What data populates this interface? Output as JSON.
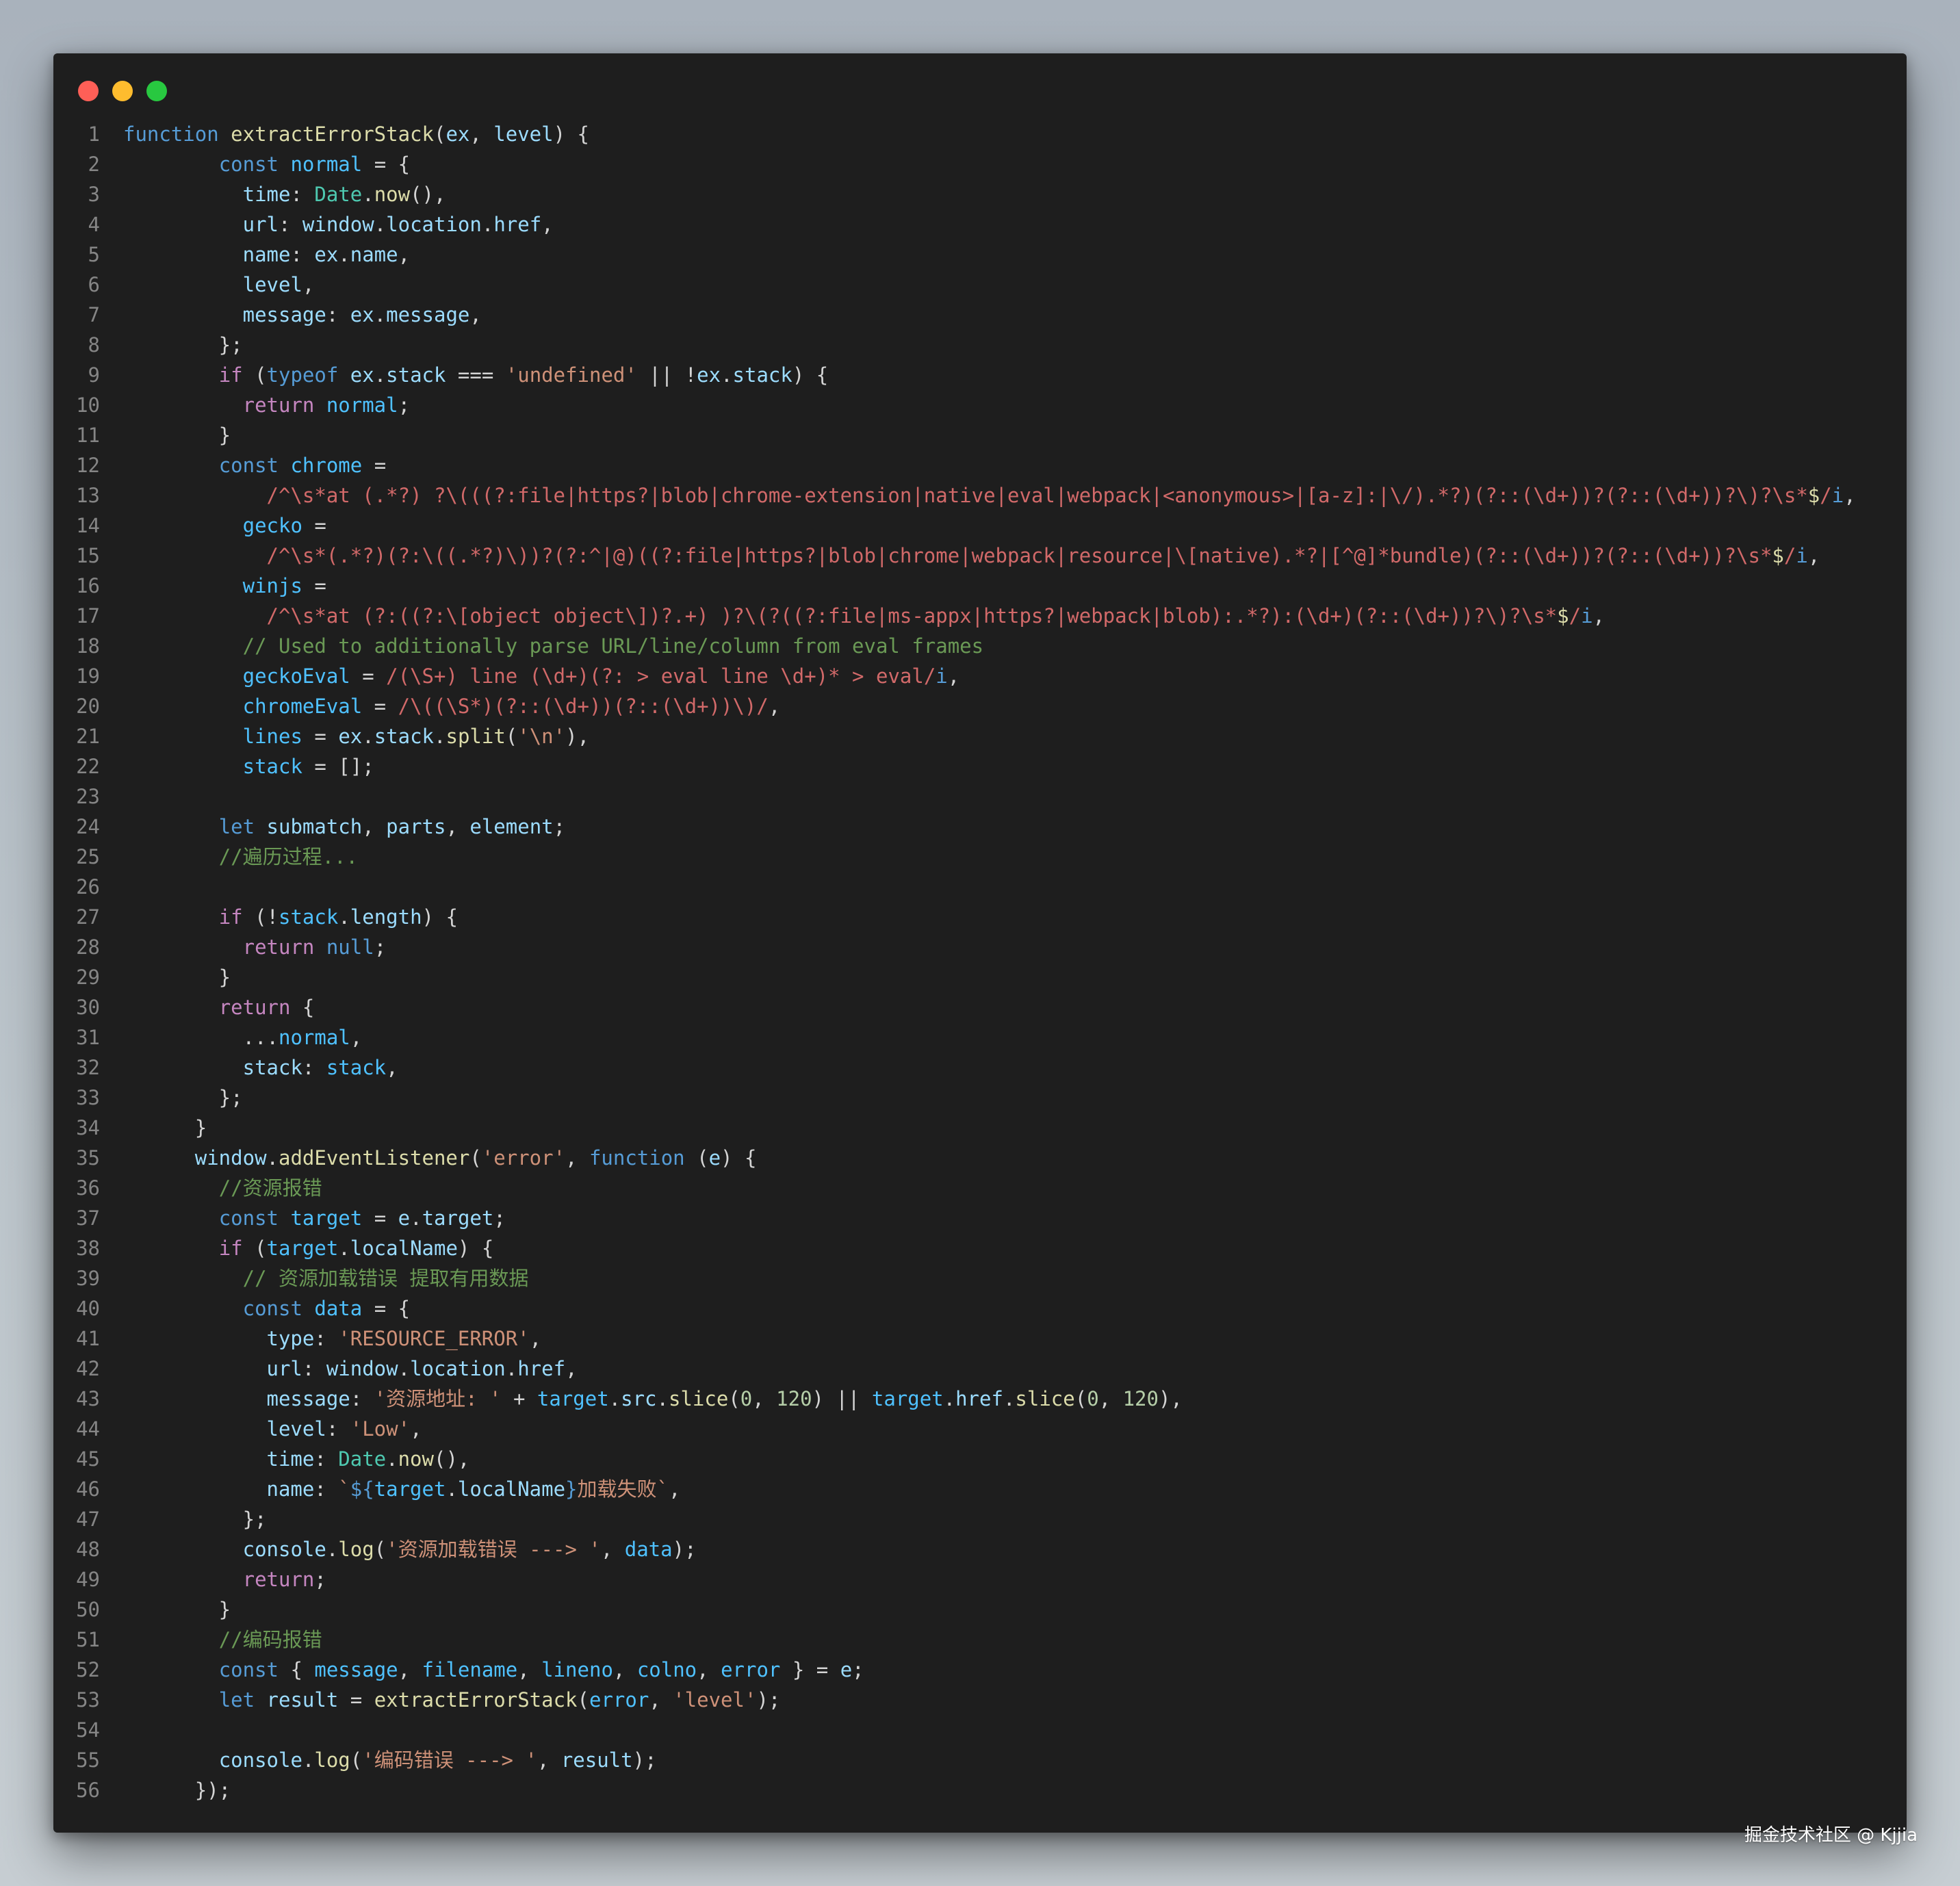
{
  "window": {
    "controls": {
      "close_color": "#ff5f57",
      "minimize_color": "#febc2e",
      "maximize_color": "#28c840"
    }
  },
  "code": {
    "lines": [
      [
        [
          "k",
          "function"
        ],
        [
          "t",
          " "
        ],
        [
          "f",
          "extractErrorStack"
        ],
        [
          "t",
          "("
        ],
        [
          "v",
          "ex"
        ],
        [
          "t",
          ", "
        ],
        [
          "v",
          "level"
        ],
        [
          "t",
          ") {"
        ]
      ],
      [
        [
          "t",
          "        "
        ],
        [
          "k",
          "const"
        ],
        [
          "t",
          " "
        ],
        [
          "b",
          "normal"
        ],
        [
          "t",
          " = {"
        ]
      ],
      [
        [
          "t",
          "          "
        ],
        [
          "v",
          "time"
        ],
        [
          "t",
          ": "
        ],
        [
          "t2",
          "Date"
        ],
        [
          "t",
          "."
        ],
        [
          "f",
          "now"
        ],
        [
          "t",
          "(),"
        ]
      ],
      [
        [
          "t",
          "          "
        ],
        [
          "v",
          "url"
        ],
        [
          "t",
          ": "
        ],
        [
          "v",
          "window"
        ],
        [
          "t",
          "."
        ],
        [
          "v",
          "location"
        ],
        [
          "t",
          "."
        ],
        [
          "v",
          "href"
        ],
        [
          "t",
          ","
        ]
      ],
      [
        [
          "t",
          "          "
        ],
        [
          "v",
          "name"
        ],
        [
          "t",
          ": "
        ],
        [
          "v",
          "ex"
        ],
        [
          "t",
          "."
        ],
        [
          "v",
          "name"
        ],
        [
          "t",
          ","
        ]
      ],
      [
        [
          "t",
          "          "
        ],
        [
          "v",
          "level"
        ],
        [
          "t",
          ","
        ]
      ],
      [
        [
          "t",
          "          "
        ],
        [
          "v",
          "message"
        ],
        [
          "t",
          ": "
        ],
        [
          "v",
          "ex"
        ],
        [
          "t",
          "."
        ],
        [
          "v",
          "message"
        ],
        [
          "t",
          ","
        ]
      ],
      [
        [
          "t",
          "        };"
        ]
      ],
      [
        [
          "t",
          "        "
        ],
        [
          "c",
          "if"
        ],
        [
          "t",
          " ("
        ],
        [
          "k",
          "typeof"
        ],
        [
          "t",
          " "
        ],
        [
          "v",
          "ex"
        ],
        [
          "t",
          "."
        ],
        [
          "v",
          "stack"
        ],
        [
          "t",
          " === "
        ],
        [
          "s",
          "'undefined'"
        ],
        [
          "t",
          " || !"
        ],
        [
          "v",
          "ex"
        ],
        [
          "t",
          "."
        ],
        [
          "v",
          "stack"
        ],
        [
          "t",
          ") {"
        ]
      ],
      [
        [
          "t",
          "          "
        ],
        [
          "c",
          "return"
        ],
        [
          "t",
          " "
        ],
        [
          "b",
          "normal"
        ],
        [
          "t",
          ";"
        ]
      ],
      [
        [
          "t",
          "        }"
        ]
      ],
      [
        [
          "t",
          "        "
        ],
        [
          "k",
          "const"
        ],
        [
          "t",
          " "
        ],
        [
          "b",
          "chrome"
        ],
        [
          "t",
          " ="
        ]
      ],
      [
        [
          "t",
          "            "
        ],
        [
          "r",
          "/^\\s*at (.*?) ?\\(((?:file|https?|blob|chrome-extension|native|eval|webpack|<anonymous>|[a-z]:|\\/).*?)(?::(\\d+))?(?::(\\d+))?\\)?\\s*"
        ],
        [
          "y",
          "$"
        ],
        [
          "r",
          "/"
        ],
        [
          "k",
          "i"
        ],
        [
          "t",
          ","
        ]
      ],
      [
        [
          "t",
          "          "
        ],
        [
          "b",
          "gecko"
        ],
        [
          "t",
          " ="
        ]
      ],
      [
        [
          "t",
          "            "
        ],
        [
          "r",
          "/^\\s*(.*?)(?:\\((.*?)\\))?(?:^|@)((?:file|https?|blob|chrome|webpack|resource|\\[native).*?|[^@]*bundle)(?::(\\d+))?(?::(\\d+))?\\s*"
        ],
        [
          "y",
          "$"
        ],
        [
          "r",
          "/"
        ],
        [
          "k",
          "i"
        ],
        [
          "t",
          ","
        ]
      ],
      [
        [
          "t",
          "          "
        ],
        [
          "b",
          "winjs"
        ],
        [
          "t",
          " ="
        ]
      ],
      [
        [
          "t",
          "            "
        ],
        [
          "r",
          "/^\\s*at (?:((?:\\[object object\\])?.+) )?\\(?((?:file|ms-appx|https?|webpack|blob):.*?):(\\d+)(?::(\\d+))?\\)?\\s*"
        ],
        [
          "y",
          "$"
        ],
        [
          "r",
          "/"
        ],
        [
          "k",
          "i"
        ],
        [
          "t",
          ","
        ]
      ],
      [
        [
          "t",
          "          "
        ],
        [
          "cm",
          "// Used to additionally parse URL/line/column from eval frames"
        ]
      ],
      [
        [
          "t",
          "          "
        ],
        [
          "b",
          "geckoEval"
        ],
        [
          "t",
          " = "
        ],
        [
          "r",
          "/(\\S+) line (\\d+)(?: > eval line \\d+)* > eval/"
        ],
        [
          "k",
          "i"
        ],
        [
          "t",
          ","
        ]
      ],
      [
        [
          "t",
          "          "
        ],
        [
          "b",
          "chromeEval"
        ],
        [
          "t",
          " = "
        ],
        [
          "r",
          "/\\((\\S*)(?::(\\d+))(?::(\\d+))\\)/"
        ],
        [
          "t",
          ","
        ]
      ],
      [
        [
          "t",
          "          "
        ],
        [
          "b",
          "lines"
        ],
        [
          "t",
          " = "
        ],
        [
          "v",
          "ex"
        ],
        [
          "t",
          "."
        ],
        [
          "v",
          "stack"
        ],
        [
          "t",
          "."
        ],
        [
          "f",
          "split"
        ],
        [
          "t",
          "("
        ],
        [
          "s",
          "'\\n'"
        ],
        [
          "t",
          "),"
        ]
      ],
      [
        [
          "t",
          "          "
        ],
        [
          "b",
          "stack"
        ],
        [
          "t",
          " = [];"
        ]
      ],
      [],
      [
        [
          "t",
          "        "
        ],
        [
          "k",
          "let"
        ],
        [
          "t",
          " "
        ],
        [
          "v",
          "submatch"
        ],
        [
          "t",
          ", "
        ],
        [
          "v",
          "parts"
        ],
        [
          "t",
          ", "
        ],
        [
          "v",
          "element"
        ],
        [
          "t",
          ";"
        ]
      ],
      [
        [
          "t",
          "        "
        ],
        [
          "cm",
          "//遍历过程..."
        ]
      ],
      [],
      [
        [
          "t",
          "        "
        ],
        [
          "c",
          "if"
        ],
        [
          "t",
          " (!"
        ],
        [
          "b",
          "stack"
        ],
        [
          "t",
          "."
        ],
        [
          "v",
          "length"
        ],
        [
          "t",
          ") {"
        ]
      ],
      [
        [
          "t",
          "          "
        ],
        [
          "c",
          "return"
        ],
        [
          "t",
          " "
        ],
        [
          "k",
          "null"
        ],
        [
          "t",
          ";"
        ]
      ],
      [
        [
          "t",
          "        }"
        ]
      ],
      [
        [
          "t",
          "        "
        ],
        [
          "c",
          "return"
        ],
        [
          "t",
          " {"
        ]
      ],
      [
        [
          "t",
          "          ..."
        ],
        [
          "b",
          "normal"
        ],
        [
          "t",
          ","
        ]
      ],
      [
        [
          "t",
          "          "
        ],
        [
          "v",
          "stack"
        ],
        [
          "t",
          ": "
        ],
        [
          "b",
          "stack"
        ],
        [
          "t",
          ","
        ]
      ],
      [
        [
          "t",
          "        };"
        ]
      ],
      [
        [
          "t",
          "      }"
        ]
      ],
      [
        [
          "t",
          "      "
        ],
        [
          "v",
          "window"
        ],
        [
          "t",
          "."
        ],
        [
          "f",
          "addEventListener"
        ],
        [
          "t",
          "("
        ],
        [
          "s",
          "'error'"
        ],
        [
          "t",
          ", "
        ],
        [
          "k",
          "function"
        ],
        [
          "t",
          " ("
        ],
        [
          "v",
          "e"
        ],
        [
          "t",
          ") {"
        ]
      ],
      [
        [
          "t",
          "        "
        ],
        [
          "cm",
          "//资源报错"
        ]
      ],
      [
        [
          "t",
          "        "
        ],
        [
          "k",
          "const"
        ],
        [
          "t",
          " "
        ],
        [
          "b",
          "target"
        ],
        [
          "t",
          " = "
        ],
        [
          "v",
          "e"
        ],
        [
          "t",
          "."
        ],
        [
          "v",
          "target"
        ],
        [
          "t",
          ";"
        ]
      ],
      [
        [
          "t",
          "        "
        ],
        [
          "c",
          "if"
        ],
        [
          "t",
          " ("
        ],
        [
          "b",
          "target"
        ],
        [
          "t",
          "."
        ],
        [
          "v",
          "localName"
        ],
        [
          "t",
          ") {"
        ]
      ],
      [
        [
          "t",
          "          "
        ],
        [
          "cm",
          "// 资源加载错误 提取有用数据"
        ]
      ],
      [
        [
          "t",
          "          "
        ],
        [
          "k",
          "const"
        ],
        [
          "t",
          " "
        ],
        [
          "b",
          "data"
        ],
        [
          "t",
          " = {"
        ]
      ],
      [
        [
          "t",
          "            "
        ],
        [
          "v",
          "type"
        ],
        [
          "t",
          ": "
        ],
        [
          "s",
          "'RESOURCE_ERROR'"
        ],
        [
          "t",
          ","
        ]
      ],
      [
        [
          "t",
          "            "
        ],
        [
          "v",
          "url"
        ],
        [
          "t",
          ": "
        ],
        [
          "v",
          "window"
        ],
        [
          "t",
          "."
        ],
        [
          "v",
          "location"
        ],
        [
          "t",
          "."
        ],
        [
          "v",
          "href"
        ],
        [
          "t",
          ","
        ]
      ],
      [
        [
          "t",
          "            "
        ],
        [
          "v",
          "message"
        ],
        [
          "t",
          ": "
        ],
        [
          "s",
          "'资源地址: '"
        ],
        [
          "t",
          " + "
        ],
        [
          "b",
          "target"
        ],
        [
          "t",
          "."
        ],
        [
          "v",
          "src"
        ],
        [
          "t",
          "."
        ],
        [
          "f",
          "slice"
        ],
        [
          "t",
          "("
        ],
        [
          "n",
          "0"
        ],
        [
          "t",
          ", "
        ],
        [
          "n",
          "120"
        ],
        [
          "t",
          ") || "
        ],
        [
          "b",
          "target"
        ],
        [
          "t",
          "."
        ],
        [
          "v",
          "href"
        ],
        [
          "t",
          "."
        ],
        [
          "f",
          "slice"
        ],
        [
          "t",
          "("
        ],
        [
          "n",
          "0"
        ],
        [
          "t",
          ", "
        ],
        [
          "n",
          "120"
        ],
        [
          "t",
          "),"
        ]
      ],
      [
        [
          "t",
          "            "
        ],
        [
          "v",
          "level"
        ],
        [
          "t",
          ": "
        ],
        [
          "s",
          "'Low'"
        ],
        [
          "t",
          ","
        ]
      ],
      [
        [
          "t",
          "            "
        ],
        [
          "v",
          "time"
        ],
        [
          "t",
          ": "
        ],
        [
          "t2",
          "Date"
        ],
        [
          "t",
          "."
        ],
        [
          "f",
          "now"
        ],
        [
          "t",
          "(),"
        ]
      ],
      [
        [
          "t",
          "            "
        ],
        [
          "v",
          "name"
        ],
        [
          "t",
          ": "
        ],
        [
          "s",
          "`"
        ],
        [
          "k",
          "${"
        ],
        [
          "b",
          "target"
        ],
        [
          "t",
          "."
        ],
        [
          "v",
          "localName"
        ],
        [
          "k",
          "}"
        ],
        [
          "s",
          "加载失败`"
        ],
        [
          "t",
          ","
        ]
      ],
      [
        [
          "t",
          "          };"
        ]
      ],
      [
        [
          "t",
          "          "
        ],
        [
          "v",
          "console"
        ],
        [
          "t",
          "."
        ],
        [
          "f",
          "log"
        ],
        [
          "t",
          "("
        ],
        [
          "s",
          "'资源加载错误 ---> '"
        ],
        [
          "t",
          ", "
        ],
        [
          "b",
          "data"
        ],
        [
          "t",
          ");"
        ]
      ],
      [
        [
          "t",
          "          "
        ],
        [
          "c",
          "return"
        ],
        [
          "t",
          ";"
        ]
      ],
      [
        [
          "t",
          "        }"
        ]
      ],
      [
        [
          "t",
          "        "
        ],
        [
          "cm",
          "//编码报错"
        ]
      ],
      [
        [
          "t",
          "        "
        ],
        [
          "k",
          "const"
        ],
        [
          "t",
          " { "
        ],
        [
          "b",
          "message"
        ],
        [
          "t",
          ", "
        ],
        [
          "b",
          "filename"
        ],
        [
          "t",
          ", "
        ],
        [
          "b",
          "lineno"
        ],
        [
          "t",
          ", "
        ],
        [
          "b",
          "colno"
        ],
        [
          "t",
          ", "
        ],
        [
          "b",
          "error"
        ],
        [
          "t",
          " } = "
        ],
        [
          "v",
          "e"
        ],
        [
          "t",
          ";"
        ]
      ],
      [
        [
          "t",
          "        "
        ],
        [
          "k",
          "let"
        ],
        [
          "t",
          " "
        ],
        [
          "v",
          "result"
        ],
        [
          "t",
          " = "
        ],
        [
          "f",
          "extractErrorStack"
        ],
        [
          "t",
          "("
        ],
        [
          "b",
          "error"
        ],
        [
          "t",
          ", "
        ],
        [
          "s",
          "'level'"
        ],
        [
          "t",
          ");"
        ]
      ],
      [],
      [
        [
          "t",
          "        "
        ],
        [
          "v",
          "console"
        ],
        [
          "t",
          "."
        ],
        [
          "f",
          "log"
        ],
        [
          "t",
          "("
        ],
        [
          "s",
          "'编码错误 ---> '"
        ],
        [
          "t",
          ", "
        ],
        [
          "v",
          "result"
        ],
        [
          "t",
          ");"
        ]
      ],
      [
        [
          "t",
          "      });"
        ]
      ]
    ]
  },
  "watermark": "掘金技术社区 @ Kjjia"
}
